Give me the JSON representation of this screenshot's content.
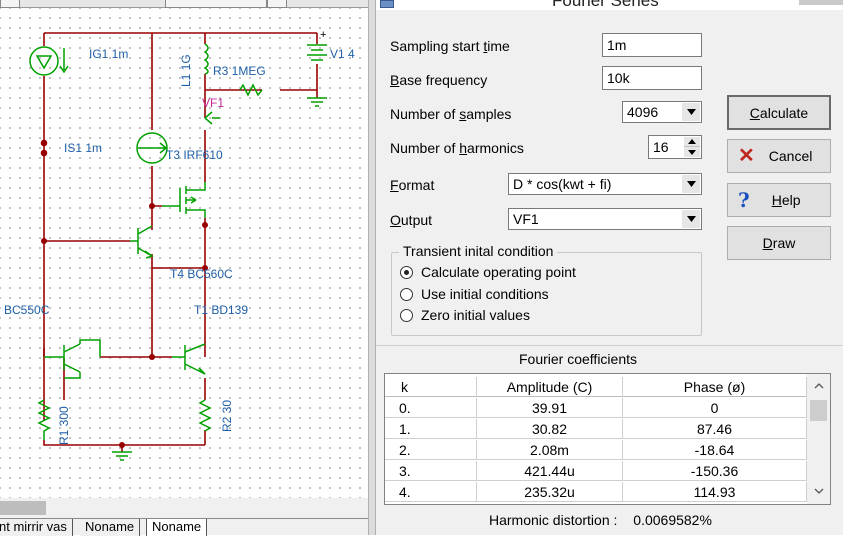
{
  "schematic": {
    "labels": {
      "ig1": "IG1 1m",
      "l1": "L1 1G",
      "r3": "R3 1MEG",
      "v1": "V1 4",
      "vf1": "VF1",
      "is1": "IS1 1m",
      "t3": "T3 IRF610",
      "t4": "T4 BC560C",
      "bc550c": "BC550C",
      "t1": "T1 BD139",
      "r1": "R1 300",
      "r2": "R2 30",
      "plus": "+"
    },
    "tabs": [
      "nt mirrir vas",
      "Noname",
      "Noname"
    ],
    "wire_color": "#990000",
    "component_color": "#00a000",
    "label_color": "#1f5fa8"
  },
  "dialog": {
    "title": "Fourier Series",
    "fields": {
      "sampling_start_time": {
        "label_pre": "Sampling start ",
        "label_u": "t",
        "label_post": "ime",
        "value": "1m"
      },
      "base_frequency": {
        "label_pre": "",
        "label_u": "B",
        "label_post": "ase frequency",
        "value": "10k"
      },
      "number_of_samples": {
        "label_pre": "Number of ",
        "label_u": "s",
        "label_post": "amples",
        "value": "4096"
      },
      "number_of_harmonics": {
        "label_pre": "Number of ",
        "label_u": "h",
        "label_post": "armonics",
        "value": "16"
      },
      "format": {
        "label_pre": "",
        "label_u": "F",
        "label_post": "ormat",
        "value": "D * cos(kwt + fi)"
      },
      "output": {
        "label_pre": "",
        "label_u": "O",
        "label_post": "utput",
        "value": "VF1"
      }
    },
    "buttons": {
      "calculate": {
        "pre": "",
        "u": "C",
        "post": "alculate"
      },
      "cancel": {
        "pre": "Cancel",
        "u": "",
        "post": ""
      },
      "help": {
        "pre": "",
        "u": "H",
        "post": "elp"
      },
      "draw": {
        "pre": "",
        "u": "D",
        "post": "raw"
      }
    },
    "transient": {
      "title": "Transient inital condition",
      "options": [
        "Calculate operating point",
        "Use initial conditions",
        "Zero initial values"
      ],
      "selected": 0
    },
    "coefficients": {
      "title": "Fourier coefficients",
      "columns": [
        "k",
        "Amplitude (C)",
        "Phase (ø)"
      ],
      "rows": [
        [
          "0.",
          "39.91",
          "0"
        ],
        [
          "1.",
          "30.82",
          "87.46"
        ],
        [
          "2.",
          "2.08m",
          "-18.64"
        ],
        [
          "3.",
          "421.44u",
          "-150.36"
        ],
        [
          "4.",
          "235.32u",
          "114.93"
        ]
      ]
    },
    "harmonic_distortion": {
      "label": "Harmonic distortion :",
      "value": "0.0069582%"
    }
  }
}
